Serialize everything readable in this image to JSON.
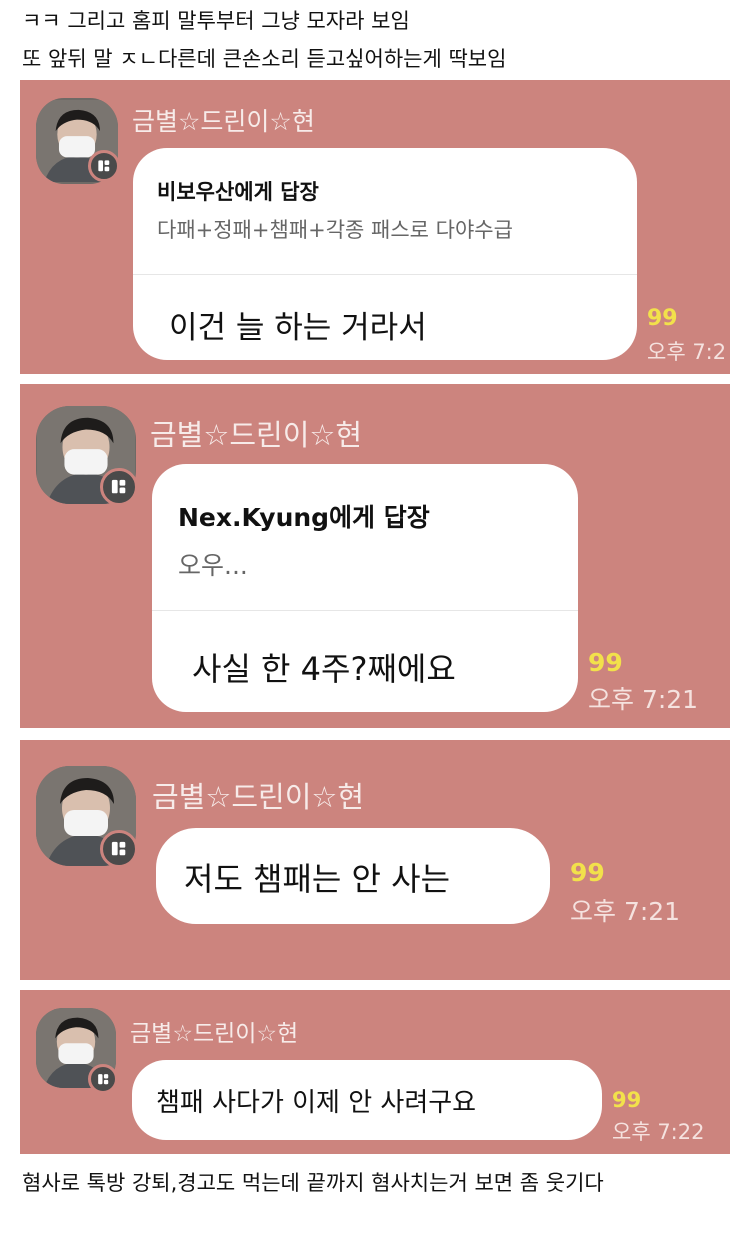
{
  "caption": {
    "line1": "ㅋㅋ 그리고 홈피 말투부터 그냥 모자라 보임",
    "line2": "또 앞뒤 말 ㅈㄴ다른데 큰손소리 듣고싶어하는게 딱보임",
    "line3": "혐사로 톡방 강퇴,경고도 먹는데 끝까지 혐사치는거 보면 좀 웃기다"
  },
  "colors": {
    "panel_bg": "#cc847e",
    "bubble_bg": "#ffffff",
    "unread_count": "#f2e14b",
    "sender_name": "#f7ebe9"
  },
  "messages": [
    {
      "sender": "금별☆드린이☆현",
      "reply_to": "비보우산에게 답장",
      "quote": "다패+정패+챔패+각종 패스로 다야수급",
      "text": "이건 늘 하는 거라서",
      "unread": "99",
      "time": "오후 7:2"
    },
    {
      "sender": "금별☆드린이☆현",
      "reply_to": "Nex.Kyung에게 답장",
      "quote": "오우...",
      "text": "사실 한 4주?째에요",
      "unread": "99",
      "time": "오후 7:21"
    },
    {
      "sender": "금별☆드린이☆현",
      "text": "저도 챔패는 안 사는",
      "unread": "99",
      "time": "오후 7:21"
    },
    {
      "sender": "금별☆드린이☆현",
      "text": "챔패 사다가 이제 안 사려구요",
      "unread": "99",
      "time": "오후 7:22"
    }
  ],
  "icons": {
    "avatar": "profile-photo-masked-person",
    "badge": "multi-profile-icon"
  }
}
